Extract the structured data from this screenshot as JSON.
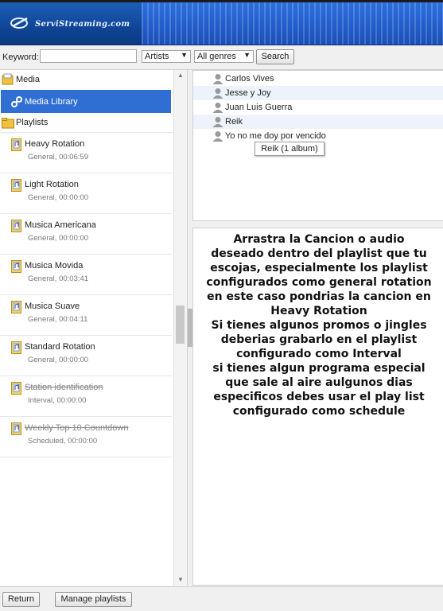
{
  "banner": {
    "logo_text": "ServiStreaming.com"
  },
  "toolbar": {
    "keyword_label": "Keyword:",
    "keyword_value": "",
    "type_select": "Artists",
    "genre_select": "All genres",
    "search_label": "Search"
  },
  "tree": {
    "media_label": "Media",
    "media_library_label": "Media Library",
    "playlists_label": "Playlists",
    "playlists": [
      {
        "name": "Heavy Rotation",
        "sub": "General, 00:06:59",
        "disabled": false
      },
      {
        "name": "Light Rotation",
        "sub": "General, 00:00:00",
        "disabled": false
      },
      {
        "name": "Musica Americana",
        "sub": "General, 00:00:00",
        "disabled": false
      },
      {
        "name": "Musica Movida",
        "sub": "General, 00:03:41",
        "disabled": false
      },
      {
        "name": "Musica Suave",
        "sub": "General, 00:04:11",
        "disabled": false
      },
      {
        "name": "Standard Rotation",
        "sub": "General, 00:00:00",
        "disabled": false
      },
      {
        "name": "Station identification",
        "sub": "Interval, 00:00:00",
        "disabled": true
      },
      {
        "name": "Weekly Top 10 Countdown",
        "sub": "Scheduled, 00:00:00",
        "disabled": true
      }
    ]
  },
  "artists": [
    "Carlos Vives",
    "Jesse y Joy",
    "Juan Luis Guerra",
    "Reik",
    "Yo no me doy por vencido"
  ],
  "tooltip": "Reik (1 album)",
  "instructions": [
    "Arrastra la Cancion o audio",
    "deseado dentro del playlist que tu",
    "escojas, especialmente los playlist",
    "configurados como general rotation",
    "en este caso pondrias la cancion en",
    "Heavy Rotation",
    "Si tienes algunos promos o jingles",
    "deberias grabarlo en el playlist",
    "configurado como Interval",
    "si tienes algun programa especial",
    "que sale al aire aulgunos dias",
    "especificos debes usar el play list",
    "configurado como schedule"
  ],
  "bottom": {
    "return_label": "Return",
    "manage_label": "Manage playlists"
  },
  "colors": {
    "selection": "#2f6fd3",
    "banner": "#1a4fb8"
  }
}
